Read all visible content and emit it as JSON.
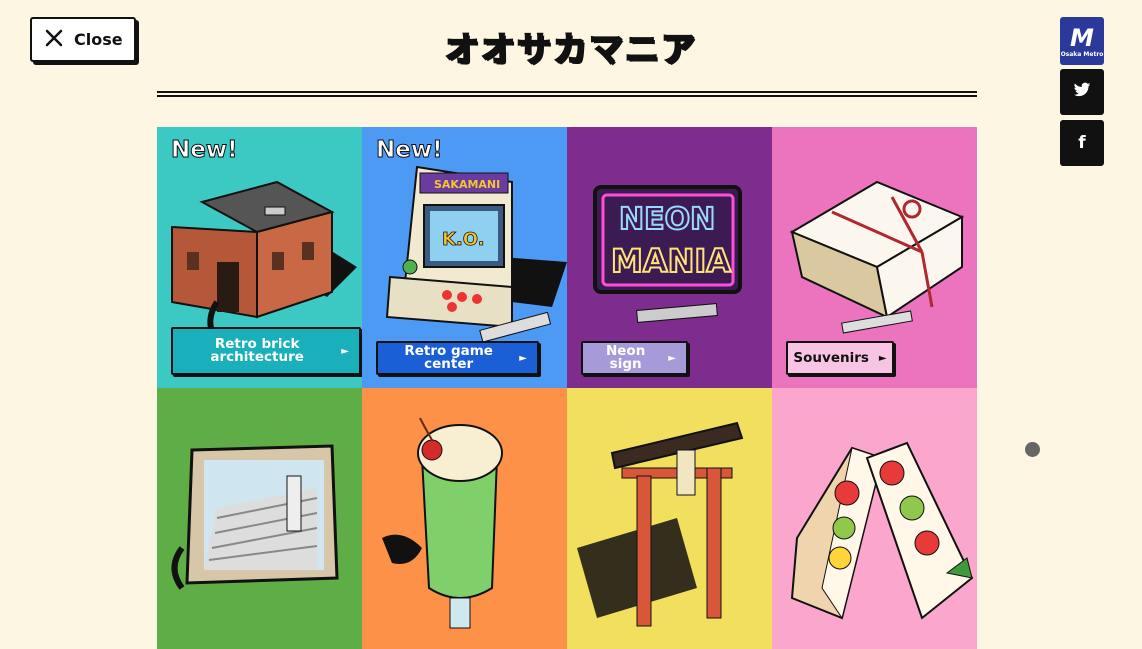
{
  "close_button": {
    "icon": "close-icon",
    "label": "Close"
  },
  "header": {
    "title": "オオサカマニア"
  },
  "brand": {
    "logo_mark": "M",
    "logo_text": "Osaka Metro"
  },
  "social": [
    {
      "name": "twitter",
      "icon": "twitter-icon",
      "glyph": "🐦"
    },
    {
      "name": "facebook",
      "icon": "facebook-icon",
      "glyph": "f"
    }
  ],
  "tiles": [
    {
      "badge": "New!",
      "label": "Retro brick architecture",
      "bg": "#3cc9c4",
      "btn_bg": "#1ab0bb",
      "btn_fg": "#ffffff"
    },
    {
      "badge": "New!",
      "label": "Retro game center",
      "bg": "#4d9af5",
      "btn_bg": "#1a5fd6",
      "btn_fg": "#ffffff"
    },
    {
      "badge": "",
      "label": "Neon sign",
      "bg": "#7e2d8f",
      "btn_bg": "#a79ad8",
      "btn_fg": "#ffffff"
    },
    {
      "badge": "",
      "label": "Souvenirs",
      "bg": "#ec74bf",
      "btn_bg": "#f7c4e3",
      "btn_fg": "#111111"
    },
    {
      "badge": "",
      "label": "",
      "bg": "#5fad47"
    },
    {
      "badge": "",
      "label": "",
      "bg": "#fd9147"
    },
    {
      "badge": "",
      "label": "",
      "bg": "#f3df5e"
    },
    {
      "badge": "",
      "label": "",
      "bg": "#fba6cc"
    }
  ],
  "neon": {
    "line1": "NEON",
    "line2": "MANIA"
  },
  "arcade": {
    "brand": "SAKAMANI",
    "screen": "K.O."
  }
}
